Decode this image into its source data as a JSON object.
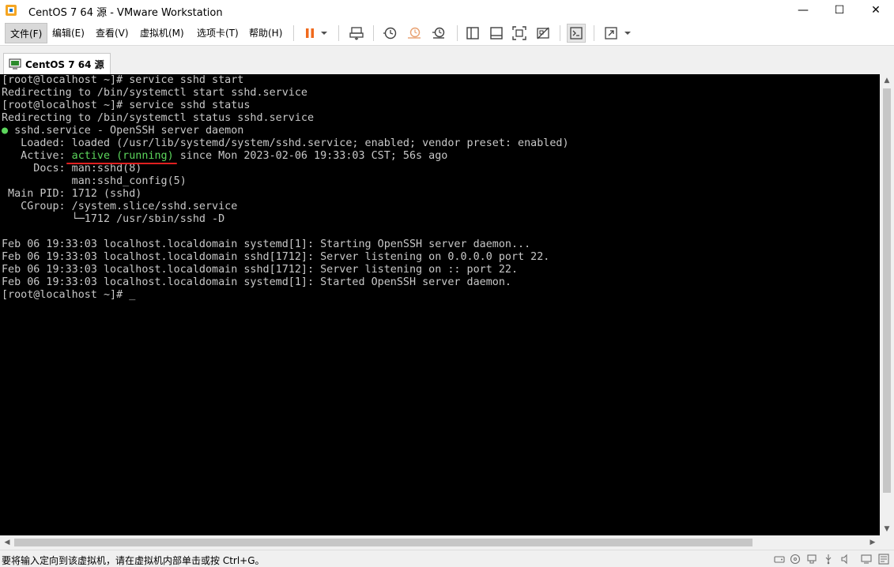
{
  "window": {
    "title": "CentOS 7 64 源 - VMware Workstation",
    "minimize_glyph": "—",
    "maximize_glyph": "☐",
    "close_glyph": "✕"
  },
  "menu": {
    "file": "文件(F)",
    "edit": "编辑(E)",
    "view": "查看(V)",
    "vm": "虚拟机(M)",
    "tabs": "选项卡(T)",
    "help": "帮助(H)"
  },
  "tab": {
    "label": "CentOS 7 64 源",
    "close_glyph": "✕"
  },
  "console": {
    "lines": [
      "[root@localhost ~]# service sshd start",
      "Redirecting to /bin/systemctl start sshd.service",
      "[root@localhost ~]# service sshd status",
      "Redirecting to /bin/systemctl status sshd.service"
    ],
    "service_bullet": "●",
    "service_line": " sshd.service - OpenSSH server daemon",
    "loaded_line": "   Loaded: loaded (/usr/lib/systemd/system/sshd.service; enabled; vendor preset: enabled)",
    "active_prefix": "   Active:",
    "active_status": " active (running)",
    "active_suffix": " since Mon 2023-02-06 19:33:03 CST; 56s ago",
    "detail_lines": [
      "     Docs: man:sshd(8)",
      "           man:sshd_config(5)",
      " Main PID: 1712 (sshd)",
      "   CGroup: /system.slice/sshd.service",
      "           └─1712 /usr/sbin/sshd -D",
      "",
      "Feb 06 19:33:03 localhost.localdomain systemd[1]: Starting OpenSSH server daemon...",
      "Feb 06 19:33:03 localhost.localdomain sshd[1712]: Server listening on 0.0.0.0 port 22.",
      "Feb 06 19:33:03 localhost.localdomain sshd[1712]: Server listening on :: port 22.",
      "Feb 06 19:33:03 localhost.localdomain systemd[1]: Started OpenSSH server daemon."
    ],
    "prompt": "[root@localhost ~]# _"
  },
  "statusbar": {
    "message": "要将输入定向到该虚拟机，请在虚拟机内部单击或按 Ctrl+G。"
  },
  "colors": {
    "terminal_bg": "#000000",
    "terminal_fg": "#c8c8c8",
    "running_green": "#5cd65c",
    "annotation_red": "#e02020",
    "pause_orange": "#f06a1d"
  }
}
